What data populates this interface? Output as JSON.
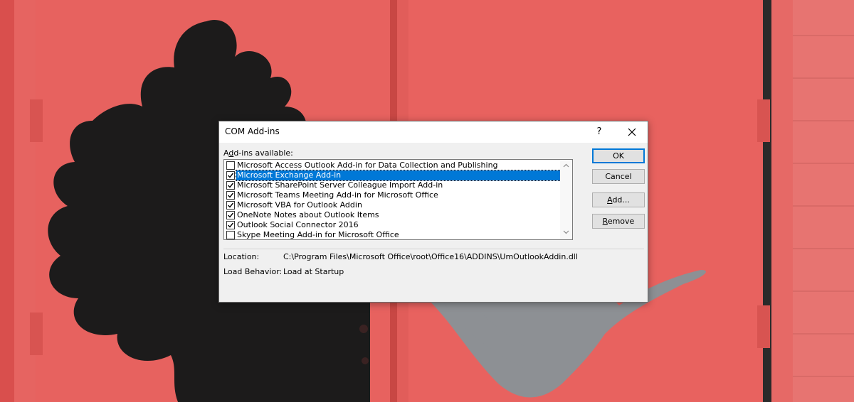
{
  "dialog": {
    "title": "COM Add-ins",
    "help_glyph": "?",
    "close_glyph": "✕",
    "available_label_prefix": "A",
    "available_label_access": "d",
    "available_label_suffix": "d-ins available:",
    "addins": [
      {
        "label": "Microsoft Access Outlook Add-in for Data Collection and Publishing",
        "checked": false,
        "selected": false
      },
      {
        "label": "Microsoft Exchange Add-in",
        "checked": true,
        "selected": true
      },
      {
        "label": "Microsoft SharePoint Server Colleague Import Add-in",
        "checked": true,
        "selected": false
      },
      {
        "label": "Microsoft Teams Meeting Add-in for Microsoft Office",
        "checked": true,
        "selected": false
      },
      {
        "label": "Microsoft VBA for Outlook Addin",
        "checked": true,
        "selected": false
      },
      {
        "label": "OneNote Notes about Outlook Items",
        "checked": true,
        "selected": false
      },
      {
        "label": "Outlook Social Connector 2016",
        "checked": true,
        "selected": false
      },
      {
        "label": "Skype Meeting Add-in for Microsoft Office",
        "checked": false,
        "selected": false
      }
    ],
    "buttons": {
      "ok": "OK",
      "cancel": "Cancel",
      "add_access": "A",
      "add_rest": "dd...",
      "remove_access": "R",
      "remove_rest": "emove"
    },
    "location_label": "Location:",
    "location_value": "C:\\Program Files\\Microsoft Office\\root\\Office16\\ADDINS\\UmOutlookAddin.dll",
    "load_behavior_label": "Load Behavior:",
    "load_behavior_value": "Load at Startup"
  },
  "colors": {
    "accent": "#0078d7",
    "wall": "#e35e5b"
  }
}
